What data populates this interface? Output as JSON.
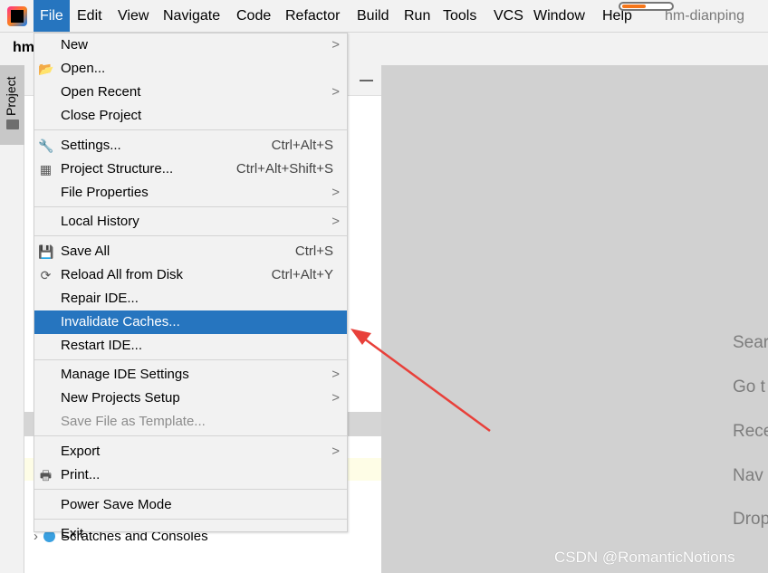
{
  "menubar": {
    "items": [
      "File",
      "Edit",
      "View",
      "Navigate",
      "Code",
      "Refactor",
      "Build",
      "Run",
      "Tools",
      "VCS",
      "Window",
      "Help"
    ],
    "active": "File",
    "project_title": "hm-dianping"
  },
  "toolbar": {
    "project_name": "hm"
  },
  "sidebar": {
    "tab": "Project"
  },
  "project_tree": {
    "item": "Scratches and Consoles"
  },
  "editor": {
    "hints": [
      "Sear",
      "Go t",
      "Rece",
      "Nav",
      "Drop"
    ]
  },
  "watermark": "CSDN @RomanticNotions",
  "file_menu": {
    "items": [
      {
        "label": "New",
        "submenu": true
      },
      {
        "label": "Open...",
        "icon": "folder-open-icon"
      },
      {
        "label": "Open Recent",
        "submenu": true
      },
      {
        "label": "Close Project"
      },
      {
        "sep": true
      },
      {
        "label": "Settings...",
        "shortcut": "Ctrl+Alt+S",
        "icon": "wrench-icon"
      },
      {
        "label": "Project Structure...",
        "shortcut": "Ctrl+Alt+Shift+S",
        "icon": "project-structure-icon"
      },
      {
        "label": "File Properties",
        "submenu": true
      },
      {
        "sep": true
      },
      {
        "label": "Local History",
        "submenu": true
      },
      {
        "sep": true
      },
      {
        "label": "Save All",
        "shortcut": "Ctrl+S",
        "icon": "save-icon"
      },
      {
        "label": "Reload All from Disk",
        "shortcut": "Ctrl+Alt+Y",
        "icon": "reload-icon"
      },
      {
        "label": "Repair IDE..."
      },
      {
        "label": "Invalidate Caches...",
        "highlighted": true
      },
      {
        "label": "Restart IDE..."
      },
      {
        "sep": true
      },
      {
        "label": "Manage IDE Settings",
        "submenu": true
      },
      {
        "label": "New Projects Setup",
        "submenu": true
      },
      {
        "label": "Save File as Template...",
        "disabled": true
      },
      {
        "sep": true
      },
      {
        "label": "Export",
        "submenu": true
      },
      {
        "label": "Print...",
        "icon": "print-icon"
      },
      {
        "sep": true
      },
      {
        "label": "Power Save Mode"
      },
      {
        "sep": true
      },
      {
        "label": "Exit"
      }
    ]
  },
  "colors": {
    "highlight": "#2675bf",
    "annotation_arrow": "#e8403a",
    "progress": "#f5761a"
  }
}
